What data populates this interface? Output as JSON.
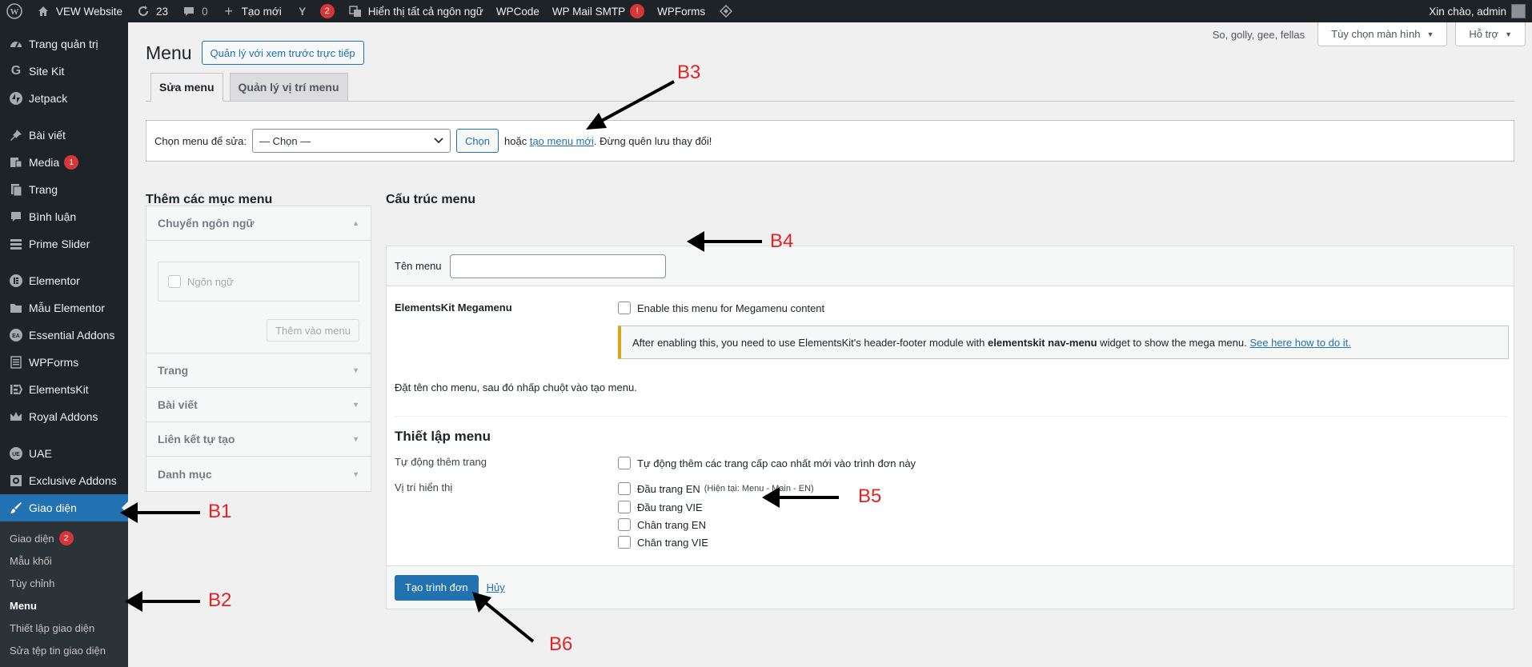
{
  "adminbar": {
    "site_name": "VEW Website",
    "updates_count": "23",
    "comments_count": "0",
    "new_label": "Tạo mới",
    "yoast_count": "2",
    "lang_label": "Hiển thị tất cả ngôn ngữ",
    "wpcode_label": "WPCode",
    "smtp_label": "WP Mail SMTP",
    "smtp_alert": "!",
    "wpforms_label": "WPForms",
    "greeting": "Xin chào, admin"
  },
  "sidebar": {
    "items": [
      {
        "label": "Trang quản trị",
        "icon": "dashboard-icon"
      },
      {
        "label": "Site Kit",
        "icon": "google-icon"
      },
      {
        "label": "Jetpack",
        "icon": "jetpack-icon"
      },
      {
        "label": "Bài viết",
        "icon": "pin-icon"
      },
      {
        "label": "Media",
        "icon": "media-icon",
        "badge": "1"
      },
      {
        "label": "Trang",
        "icon": "page-icon"
      },
      {
        "label": "Bình luận",
        "icon": "comment-icon"
      },
      {
        "label": "Prime Slider",
        "icon": "slider-icon"
      },
      {
        "label": "Elementor",
        "icon": "elementor-icon"
      },
      {
        "label": "Mẫu Elementor",
        "icon": "folder-icon"
      },
      {
        "label": "Essential Addons",
        "icon": "ea-icon"
      },
      {
        "label": "WPForms",
        "icon": "forms-icon"
      },
      {
        "label": "ElementsKit",
        "icon": "ekit-icon"
      },
      {
        "label": "Royal Addons",
        "icon": "crown-icon"
      },
      {
        "label": "UAE",
        "icon": "uae-icon"
      },
      {
        "label": "Exclusive Addons",
        "icon": "exclusive-icon"
      },
      {
        "label": "Giao diện",
        "icon": "brush-icon"
      }
    ],
    "submenu": [
      {
        "label": "Giao diện",
        "badge": "2"
      },
      {
        "label": "Mẫu khối"
      },
      {
        "label": "Tùy chỉnh"
      },
      {
        "label": "Menu"
      },
      {
        "label": "Thiết lập giao diện"
      },
      {
        "label": "Sửa tệp tin giao diện"
      }
    ]
  },
  "header": {
    "title": "Menu",
    "live_preview": "Quản lý với xem trước trực tiếp",
    "howdy": "So, golly, gee, fellas",
    "screen_options": "Tùy chọn màn hình",
    "help": "Hỗ trợ"
  },
  "tabs": [
    "Sửa menu",
    "Quản lý vị trí menu"
  ],
  "select_menu": {
    "label": "Chọn menu để sửa:",
    "selected": "— Chọn —",
    "button": "Chọn",
    "or": "hoặc",
    "create_link": "tạo menu mới",
    "remember": ". Đừng quên lưu thay đổi!"
  },
  "add_items": {
    "heading": "Thêm các mục menu",
    "sections": [
      "Chuyển ngôn ngữ",
      "Trang",
      "Bài viết",
      "Liên kết tự tạo",
      "Danh mục"
    ],
    "language_checkbox": "Ngôn ngữ",
    "add_button": "Thêm vào menu"
  },
  "structure": {
    "heading": "Cấu trúc menu",
    "name_label": "Tên menu",
    "name_value": "",
    "megamenu_label": "ElementsKit Megamenu",
    "megamenu_checkbox": "Enable this menu for Megamenu content",
    "notice_pre": "After enabling this, you need to use ElementsKit's header-footer module with ",
    "notice_bold": "elementskit nav-menu",
    "notice_post": " widget to show the mega menu. ",
    "notice_link": "See here how to do it.",
    "hint": "Đặt tên cho menu, sau đó nhấp chuột vào tạo menu.",
    "settings_heading": "Thiết lập menu",
    "auto_add_label": "Tự động thêm trang",
    "auto_add_checkbox": "Tự động thêm các trang cấp cao nhất mới vào trình đơn này",
    "location_label": "Vị trí hiển thị",
    "locations": [
      {
        "label": "Đầu trang EN",
        "note": "(Hiện tại: Menu - Main - EN)"
      },
      {
        "label": "Đầu trang VIE",
        "note": ""
      },
      {
        "label": "Chân trang EN",
        "note": ""
      },
      {
        "label": "Chân trang VIE",
        "note": ""
      }
    ],
    "create_button": "Tạo trình đơn",
    "cancel_link": "Hủy"
  },
  "annotations": [
    "B1",
    "B2",
    "B3",
    "B4",
    "B5",
    "B6"
  ],
  "colors": {
    "accent": "#2271b1",
    "annotation": "#e02424",
    "sidebar": "#1d2327",
    "notice": "#dba617"
  }
}
